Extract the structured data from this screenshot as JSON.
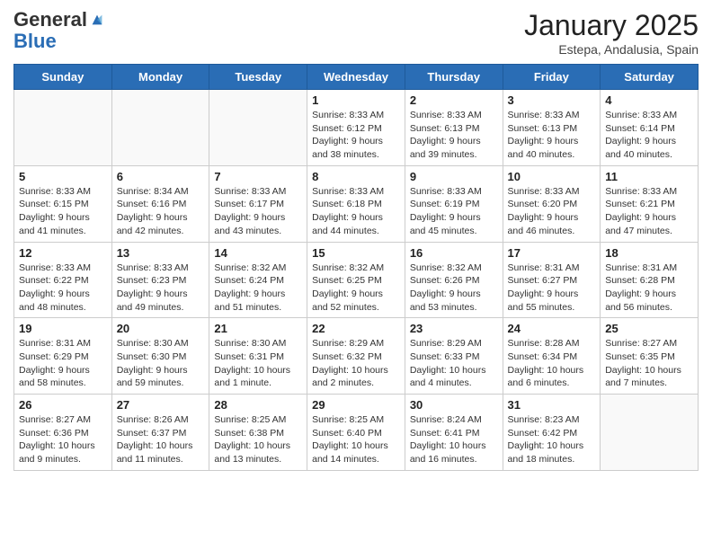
{
  "header": {
    "logo_general": "General",
    "logo_blue": "Blue",
    "title": "January 2025",
    "subtitle": "Estepa, Andalusia, Spain"
  },
  "days_of_week": [
    "Sunday",
    "Monday",
    "Tuesday",
    "Wednesday",
    "Thursday",
    "Friday",
    "Saturday"
  ],
  "weeks": [
    [
      {
        "day": "",
        "info": ""
      },
      {
        "day": "",
        "info": ""
      },
      {
        "day": "",
        "info": ""
      },
      {
        "day": "1",
        "info": "Sunrise: 8:33 AM\nSunset: 6:12 PM\nDaylight: 9 hours and 38 minutes."
      },
      {
        "day": "2",
        "info": "Sunrise: 8:33 AM\nSunset: 6:13 PM\nDaylight: 9 hours and 39 minutes."
      },
      {
        "day": "3",
        "info": "Sunrise: 8:33 AM\nSunset: 6:13 PM\nDaylight: 9 hours and 40 minutes."
      },
      {
        "day": "4",
        "info": "Sunrise: 8:33 AM\nSunset: 6:14 PM\nDaylight: 9 hours and 40 minutes."
      }
    ],
    [
      {
        "day": "5",
        "info": "Sunrise: 8:33 AM\nSunset: 6:15 PM\nDaylight: 9 hours and 41 minutes."
      },
      {
        "day": "6",
        "info": "Sunrise: 8:34 AM\nSunset: 6:16 PM\nDaylight: 9 hours and 42 minutes."
      },
      {
        "day": "7",
        "info": "Sunrise: 8:33 AM\nSunset: 6:17 PM\nDaylight: 9 hours and 43 minutes."
      },
      {
        "day": "8",
        "info": "Sunrise: 8:33 AM\nSunset: 6:18 PM\nDaylight: 9 hours and 44 minutes."
      },
      {
        "day": "9",
        "info": "Sunrise: 8:33 AM\nSunset: 6:19 PM\nDaylight: 9 hours and 45 minutes."
      },
      {
        "day": "10",
        "info": "Sunrise: 8:33 AM\nSunset: 6:20 PM\nDaylight: 9 hours and 46 minutes."
      },
      {
        "day": "11",
        "info": "Sunrise: 8:33 AM\nSunset: 6:21 PM\nDaylight: 9 hours and 47 minutes."
      }
    ],
    [
      {
        "day": "12",
        "info": "Sunrise: 8:33 AM\nSunset: 6:22 PM\nDaylight: 9 hours and 48 minutes."
      },
      {
        "day": "13",
        "info": "Sunrise: 8:33 AM\nSunset: 6:23 PM\nDaylight: 9 hours and 49 minutes."
      },
      {
        "day": "14",
        "info": "Sunrise: 8:32 AM\nSunset: 6:24 PM\nDaylight: 9 hours and 51 minutes."
      },
      {
        "day": "15",
        "info": "Sunrise: 8:32 AM\nSunset: 6:25 PM\nDaylight: 9 hours and 52 minutes."
      },
      {
        "day": "16",
        "info": "Sunrise: 8:32 AM\nSunset: 6:26 PM\nDaylight: 9 hours and 53 minutes."
      },
      {
        "day": "17",
        "info": "Sunrise: 8:31 AM\nSunset: 6:27 PM\nDaylight: 9 hours and 55 minutes."
      },
      {
        "day": "18",
        "info": "Sunrise: 8:31 AM\nSunset: 6:28 PM\nDaylight: 9 hours and 56 minutes."
      }
    ],
    [
      {
        "day": "19",
        "info": "Sunrise: 8:31 AM\nSunset: 6:29 PM\nDaylight: 9 hours and 58 minutes."
      },
      {
        "day": "20",
        "info": "Sunrise: 8:30 AM\nSunset: 6:30 PM\nDaylight: 9 hours and 59 minutes."
      },
      {
        "day": "21",
        "info": "Sunrise: 8:30 AM\nSunset: 6:31 PM\nDaylight: 10 hours and 1 minute."
      },
      {
        "day": "22",
        "info": "Sunrise: 8:29 AM\nSunset: 6:32 PM\nDaylight: 10 hours and 2 minutes."
      },
      {
        "day": "23",
        "info": "Sunrise: 8:29 AM\nSunset: 6:33 PM\nDaylight: 10 hours and 4 minutes."
      },
      {
        "day": "24",
        "info": "Sunrise: 8:28 AM\nSunset: 6:34 PM\nDaylight: 10 hours and 6 minutes."
      },
      {
        "day": "25",
        "info": "Sunrise: 8:27 AM\nSunset: 6:35 PM\nDaylight: 10 hours and 7 minutes."
      }
    ],
    [
      {
        "day": "26",
        "info": "Sunrise: 8:27 AM\nSunset: 6:36 PM\nDaylight: 10 hours and 9 minutes."
      },
      {
        "day": "27",
        "info": "Sunrise: 8:26 AM\nSunset: 6:37 PM\nDaylight: 10 hours and 11 minutes."
      },
      {
        "day": "28",
        "info": "Sunrise: 8:25 AM\nSunset: 6:38 PM\nDaylight: 10 hours and 13 minutes."
      },
      {
        "day": "29",
        "info": "Sunrise: 8:25 AM\nSunset: 6:40 PM\nDaylight: 10 hours and 14 minutes."
      },
      {
        "day": "30",
        "info": "Sunrise: 8:24 AM\nSunset: 6:41 PM\nDaylight: 10 hours and 16 minutes."
      },
      {
        "day": "31",
        "info": "Sunrise: 8:23 AM\nSunset: 6:42 PM\nDaylight: 10 hours and 18 minutes."
      },
      {
        "day": "",
        "info": ""
      }
    ]
  ]
}
